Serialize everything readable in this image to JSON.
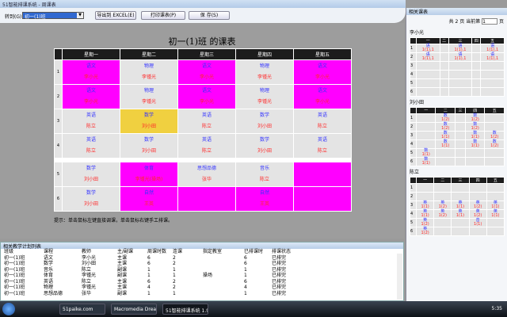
{
  "window": {
    "title": "51智能排课系统 - 周课表"
  },
  "toolbar": {
    "class_label": "转到(G)",
    "class_value": "初一(1)班",
    "export": "导出到 EXCEL(E)",
    "print": "打印课表(P)",
    "save": "保 存(S)"
  },
  "timetable": {
    "title": "初一(1)班 的课表",
    "days": [
      "星期一",
      "星期二",
      "星期三",
      "星期四",
      "星期五"
    ],
    "rows": [
      {
        "n": "1",
        "cells": [
          [
            "语文",
            "李小光",
            "#ff00ff"
          ],
          [
            "物理",
            "李锺光",
            "#e4e4e4"
          ],
          [
            "语文",
            "李小光",
            "#ff00ff"
          ],
          [
            "物理",
            "李锺光",
            "#e4e4e4"
          ],
          [
            "语文",
            "李小光",
            "#ff00ff"
          ]
        ]
      },
      {
        "n": "2",
        "cells": [
          [
            "语文",
            "李小光",
            "#ff00ff"
          ],
          [
            "物理",
            "李锺光",
            "#e4e4e4"
          ],
          [
            "语文",
            "李小光",
            "#ff00ff"
          ],
          [
            "物理",
            "李锺光",
            "#e4e4e4"
          ],
          [
            "语文",
            "李小光",
            "#ff00ff"
          ]
        ]
      },
      {
        "n": "3",
        "cells": [
          [
            "英语",
            "陈立",
            "#e4e4e4"
          ],
          [
            "数学",
            "刘小田",
            "#f0d040"
          ],
          [
            "英语",
            "陈立",
            "#e4e4e4"
          ],
          [
            "数学",
            "刘小田",
            "#e4e4e4"
          ],
          [
            "英语",
            "陈立",
            "#e4e4e4"
          ]
        ]
      },
      {
        "n": "4",
        "cells": [
          [
            "英语",
            "陈立",
            "#e4e4e4"
          ],
          [
            "数学",
            "刘小田",
            "#e4e4e4"
          ],
          [
            "英语",
            "陈立",
            "#e4e4e4"
          ],
          [
            "数学",
            "刘小田",
            "#e4e4e4"
          ],
          [
            "英语",
            "陈立",
            "#e4e4e4"
          ]
        ]
      },
      {
        "n": "5",
        "cells": [
          [
            "数学",
            "刘小田",
            "#e4e4e4"
          ],
          [
            "体育",
            "李锺光(操场)",
            "#ff00ff"
          ],
          [
            "思想品德",
            "张华",
            "#e4e4e4"
          ],
          [
            "音乐",
            "陈立",
            "#e4e4e4"
          ],
          [
            "",
            "",
            "#ff00ff"
          ]
        ]
      },
      {
        "n": "6",
        "cells": [
          [
            "数学",
            "刘小田",
            "#e4e4e4"
          ],
          [
            "自然",
            "王英",
            "#ff00ff"
          ],
          [
            "",
            "",
            "#ff00ff"
          ],
          [
            "自然",
            "王英",
            "#ff00ff"
          ],
          [
            "",
            "",
            "#ff00ff"
          ]
        ]
      }
    ],
    "hint": "提示：单击鼠标左键直接调课，单击鼠标右键手工排课。"
  },
  "plan": {
    "title": "相关教学计划列表",
    "headers": [
      "班级",
      "课程",
      "教师",
      "主/副课",
      "周课时数",
      "连课",
      "指定教室",
      "已排课时",
      "排课状态"
    ],
    "rows": [
      [
        "初一(1)班",
        "语文",
        "李小光",
        "主课",
        "6",
        "2",
        "",
        "6",
        "已排完"
      ],
      [
        "初一(1)班",
        "数学",
        "刘小田",
        "主课",
        "6",
        "2",
        "",
        "6",
        "已排完"
      ],
      [
        "初一(1)班",
        "音乐",
        "陈立",
        "副课",
        "1",
        "1",
        "",
        "1",
        "已排完"
      ],
      [
        "初一(1)班",
        "体育",
        "李锺光",
        "副课",
        "1",
        "1",
        "操场",
        "1",
        "已排完"
      ],
      [
        "初一(1)班",
        "英语",
        "陈立",
        "主课",
        "6",
        "2",
        "",
        "6",
        "已排完"
      ],
      [
        "初一(1)班",
        "物理",
        "李锺光",
        "主课",
        "4",
        "2",
        "",
        "4",
        "已排完"
      ],
      [
        "初一(1)班",
        "思想品德",
        "张华",
        "副课",
        "1",
        "1",
        "",
        "1",
        "已排完"
      ]
    ]
  },
  "related": {
    "title": "相关课表",
    "pager": {
      "total": "共 2 页",
      "current_label": "当前第",
      "page": "1",
      "unit": "页"
    },
    "days": [
      "一",
      "二",
      "三",
      "四",
      "五"
    ],
    "teachers": [
      {
        "name": "李小光",
        "grid": [
          [
            [
              "语",
              "1(1),1"
            ],
            [
              "",
              ""
            ],
            [
              "语",
              "1(1),1"
            ],
            [
              "",
              ""
            ],
            [
              "语",
              "1(1),1"
            ]
          ],
          [
            [
              "语",
              "1(1),1"
            ],
            [
              "",
              ""
            ],
            [
              "语",
              "1(1),1"
            ],
            [
              "",
              ""
            ],
            [
              "语",
              "1(1),1"
            ]
          ],
          [],
          [],
          [],
          []
        ]
      },
      {
        "name": "刘小田",
        "grid": [
          [
            [
              "",
              ""
            ],
            [
              "数",
              "1(2)"
            ],
            [
              "",
              ""
            ],
            [
              "数",
              "1(2)"
            ],
            [
              "",
              ""
            ]
          ],
          [
            [
              "",
              ""
            ],
            [
              "数",
              "1(2)"
            ],
            [
              "",
              ""
            ],
            [
              "数",
              "1(2)"
            ],
            [
              "",
              ""
            ]
          ],
          [
            [
              "",
              ""
            ],
            [
              "数",
              "1(1)"
            ],
            [
              "",
              ""
            ],
            [
              "数",
              "1(1)"
            ],
            [
              "数",
              "1(2)"
            ]
          ],
          [
            [
              "",
              ""
            ],
            [
              "数",
              "1(1)"
            ],
            [
              "",
              ""
            ],
            [
              "数",
              "1(1)"
            ],
            [
              "数",
              "1(2)"
            ]
          ],
          [
            [
              "数",
              "1(1)"
            ]
          ],
          [
            [
              "数",
              "1(1)"
            ]
          ]
        ]
      },
      {
        "name": "陈立",
        "grid": [
          [],
          [],
          [
            [
              "英",
              "1(1)"
            ],
            [
              "英",
              "1(2)"
            ],
            [
              "英",
              "1(1)"
            ],
            [
              "英",
              "1(2)"
            ],
            [
              "英",
              "1(1)"
            ]
          ],
          [
            [
              "英",
              "1(1)"
            ],
            [
              "英",
              "1(2)"
            ],
            [
              "英",
              "1(1)"
            ],
            [
              "英",
              "1(2)"
            ],
            [
              "英",
              "1(1)"
            ]
          ],
          [
            [
              "英",
              "1(2)"
            ],
            [
              "",
              ""
            ],
            [
              "",
              ""
            ],
            [
              "音",
              "1(1)"
            ],
            [
              "",
              ""
            ]
          ],
          [
            [
              "英",
              "1(2)"
            ]
          ]
        ]
      }
    ]
  },
  "taskbar": {
    "items": [
      "51paike.com",
      "Macromedia Drea...",
      "51智能排课系统 1.9..."
    ],
    "clock": "5:35"
  }
}
